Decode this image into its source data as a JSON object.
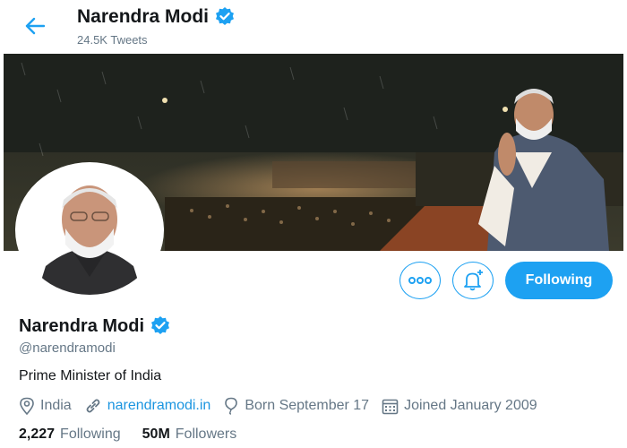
{
  "header": {
    "name": "Narendra Modi",
    "tweet_count": "24.5K Tweets"
  },
  "profile": {
    "name": "Narendra Modi",
    "handle": "@narendramodi",
    "bio": "Prime Minister of India",
    "location": "India",
    "website": "narendramodi.in",
    "born": "Born September 17",
    "joined": "Joined January 2009"
  },
  "actions": {
    "following_label": "Following"
  },
  "stats": {
    "following_count": "2,227",
    "following_label": "Following",
    "followers_count": "50M",
    "followers_label": "Followers"
  },
  "icons": {
    "back": "back-arrow-icon",
    "verified": "verified-badge-icon",
    "more": "more-options-icon",
    "notify": "bell-plus-icon",
    "location": "location-pin-icon",
    "link": "link-icon",
    "birthday": "balloon-icon",
    "calendar": "calendar-icon"
  },
  "colors": {
    "accent": "#1da1f2",
    "link": "#1b95e0",
    "secondary_text": "#657786",
    "primary_text": "#14171a"
  }
}
